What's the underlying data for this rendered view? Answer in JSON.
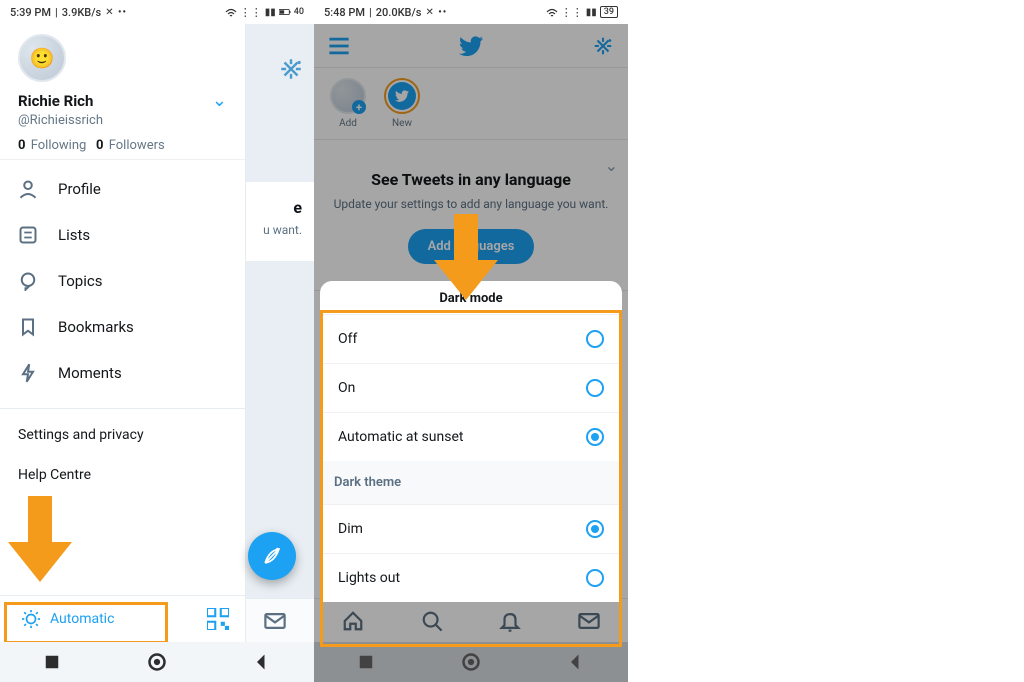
{
  "left_status": {
    "time": "5:39 PM",
    "net": "3.9KB/s",
    "extra": "✕ ••"
  },
  "right_status": {
    "time": "5:48 PM",
    "net": "20.0KB/s",
    "extra": "✕ ••"
  },
  "battery": "40",
  "user": {
    "name": "Richie Rich",
    "handle": "@Richieissrich",
    "following_count": "0",
    "following_label": "Following",
    "followers_count": "0",
    "followers_label": "Followers"
  },
  "bg_card": {
    "line1": "e",
    "line2": "u want."
  },
  "nav": {
    "profile": "Profile",
    "lists": "Lists",
    "topics": "Topics",
    "bookmarks": "Bookmarks",
    "moments": "Moments",
    "settings": "Settings and privacy",
    "help": "Help Centre",
    "automatic": "Automatic"
  },
  "story": {
    "add": "Add",
    "new": "New"
  },
  "lang": {
    "title": "See Tweets in any language",
    "sub": "Update your settings to add any language you want.",
    "btn": "Add languages"
  },
  "sheet": {
    "title": "Dark mode",
    "off": "Off",
    "on": "On",
    "auto": "Automatic at sunset",
    "theme_header": "Dark theme",
    "dim": "Dim",
    "lightsout": "Lights out"
  }
}
